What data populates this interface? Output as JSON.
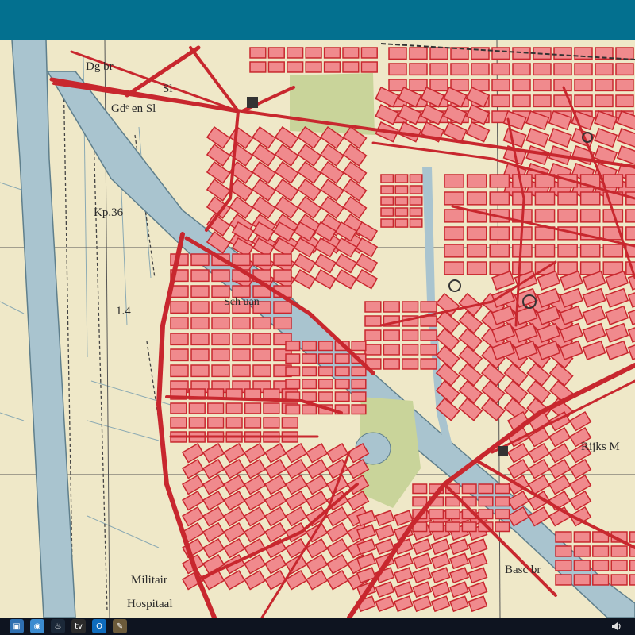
{
  "window": {
    "topbar_color": "#03708f",
    "taskbar_color": "#0e1420"
  },
  "map": {
    "colors": {
      "paper": "#efe8c8",
      "water": "#a9c4cf",
      "water_edge": "#5f7f8c",
      "road": "#c8272e",
      "block": "#f08a8d",
      "park": "#c9d49a",
      "grid_line": "#555555"
    },
    "labels": {
      "dg_br": "Dg br",
      "sl": "Sl",
      "gd_en_sl": "Gdᵉ en Sl",
      "kp36": "Kp.36",
      "value_1_4": "1.4",
      "schuan": "Sch uan",
      "rijks": "Rijks M",
      "basc_br": "Basc br",
      "militair": "Militair",
      "hospitaal": "Hospitaal"
    }
  },
  "taskbar": {
    "icons": [
      {
        "name": "virtualbox-icon",
        "glyph": "▣",
        "color": "#2f6fb0"
      },
      {
        "name": "earth-icon",
        "glyph": "◉",
        "color": "#3b8bd0"
      },
      {
        "name": "steam-icon",
        "glyph": "♨",
        "color": "#1b2838"
      },
      {
        "name": "tv-icon",
        "glyph": "tv",
        "color": "#2b2b2b"
      },
      {
        "name": "outlook-icon",
        "glyph": "O",
        "color": "#0f6cbd"
      },
      {
        "name": "gimp-icon",
        "glyph": "✎",
        "color": "#6b5a3a"
      }
    ],
    "tray_icon": "speaker-icon"
  }
}
